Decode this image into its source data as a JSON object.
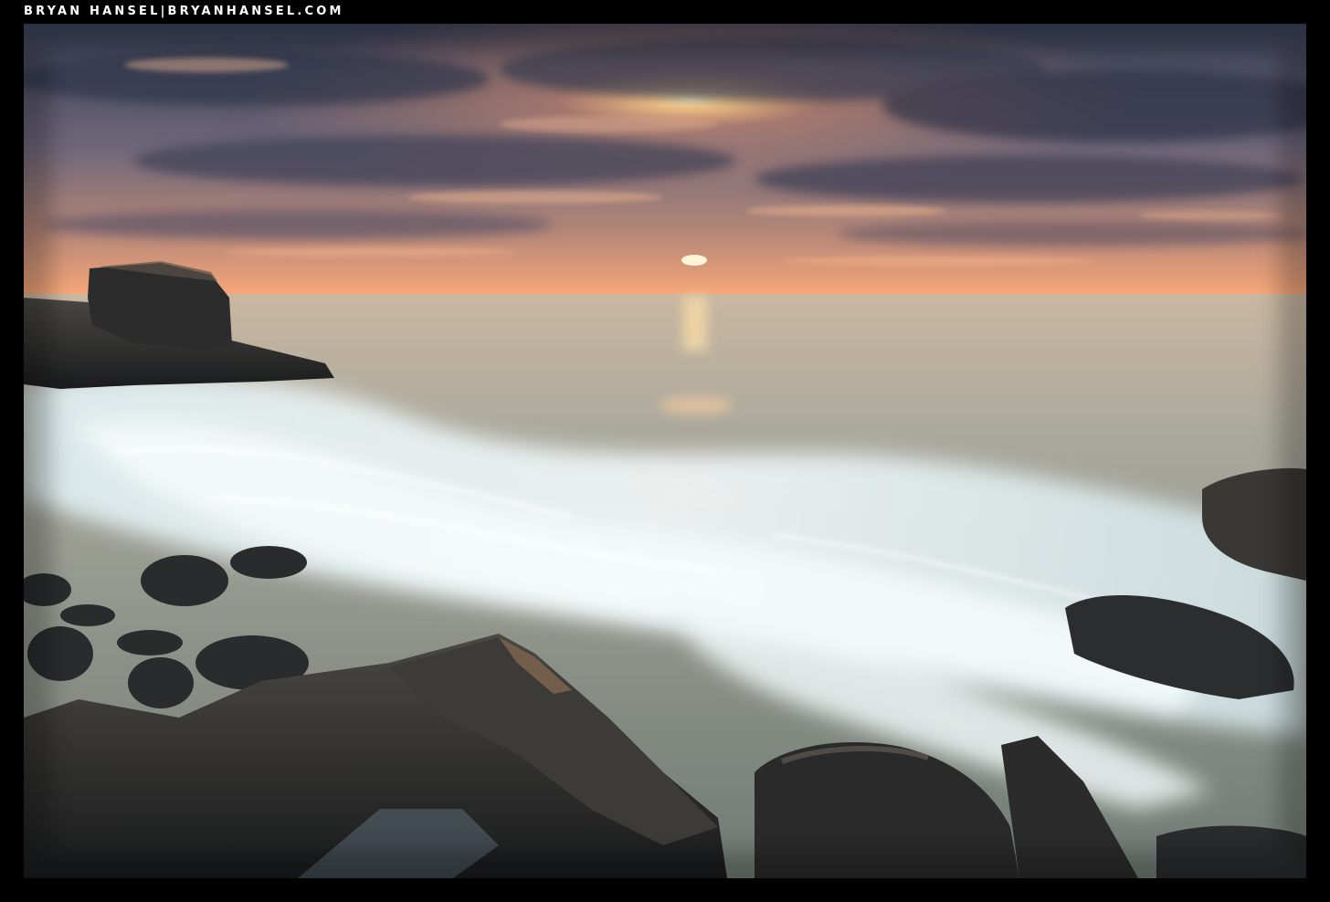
{
  "watermark": {
    "text": "BRYAN HANSEL|BRYANHANSEL.COM"
  },
  "photo": {
    "subject": "sunrise-over-lake-with-waves-and-rocks",
    "palette": {
      "sky_top": "#3a3f55",
      "sky_mid": "#7a6f82",
      "horizon_glow": "#f4a070",
      "sun": "#fff2c0",
      "water": "#b8b3a4",
      "foam": "#e8f2f4",
      "rock": "#26282b"
    }
  }
}
